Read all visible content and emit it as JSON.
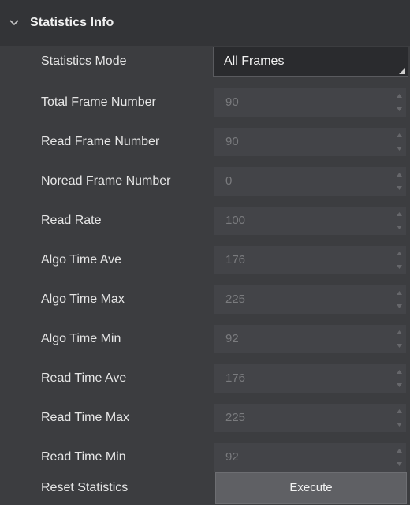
{
  "section": {
    "title": "Statistics Info",
    "expanded": true,
    "chevron_icon": "chevron-down-icon"
  },
  "statistics_mode": {
    "label": "Statistics Mode",
    "value": "All Frames"
  },
  "fields": [
    {
      "key": "total_frame_number",
      "label": "Total Frame Number",
      "value": "90"
    },
    {
      "key": "read_frame_number",
      "label": "Read Frame Number",
      "value": "90"
    },
    {
      "key": "noread_frame_number",
      "label": "Noread Frame Number",
      "value": "0"
    },
    {
      "key": "read_rate",
      "label": "Read Rate",
      "value": "100"
    },
    {
      "key": "algo_time_ave",
      "label": "Algo Time Ave",
      "value": "176"
    },
    {
      "key": "algo_time_max",
      "label": "Algo Time Max",
      "value": "225"
    },
    {
      "key": "algo_time_min",
      "label": "Algo Time Min",
      "value": "92"
    },
    {
      "key": "read_time_ave",
      "label": "Read Time Ave",
      "value": "176"
    },
    {
      "key": "read_time_max",
      "label": "Read Time Max",
      "value": "225"
    },
    {
      "key": "read_time_min",
      "label": "Read Time Min",
      "value": "92"
    }
  ],
  "reset": {
    "label": "Reset Statistics",
    "button_label": "Execute"
  },
  "colors": {
    "panel_bg": "#3c3d40",
    "header_bg": "#333437",
    "field_bg": "#434448",
    "dropdown_bg": "#2a2b2e",
    "button_bg": "#5f6064",
    "label_text": "#e6e6e6",
    "disabled_value_text": "#7a7b7e"
  }
}
